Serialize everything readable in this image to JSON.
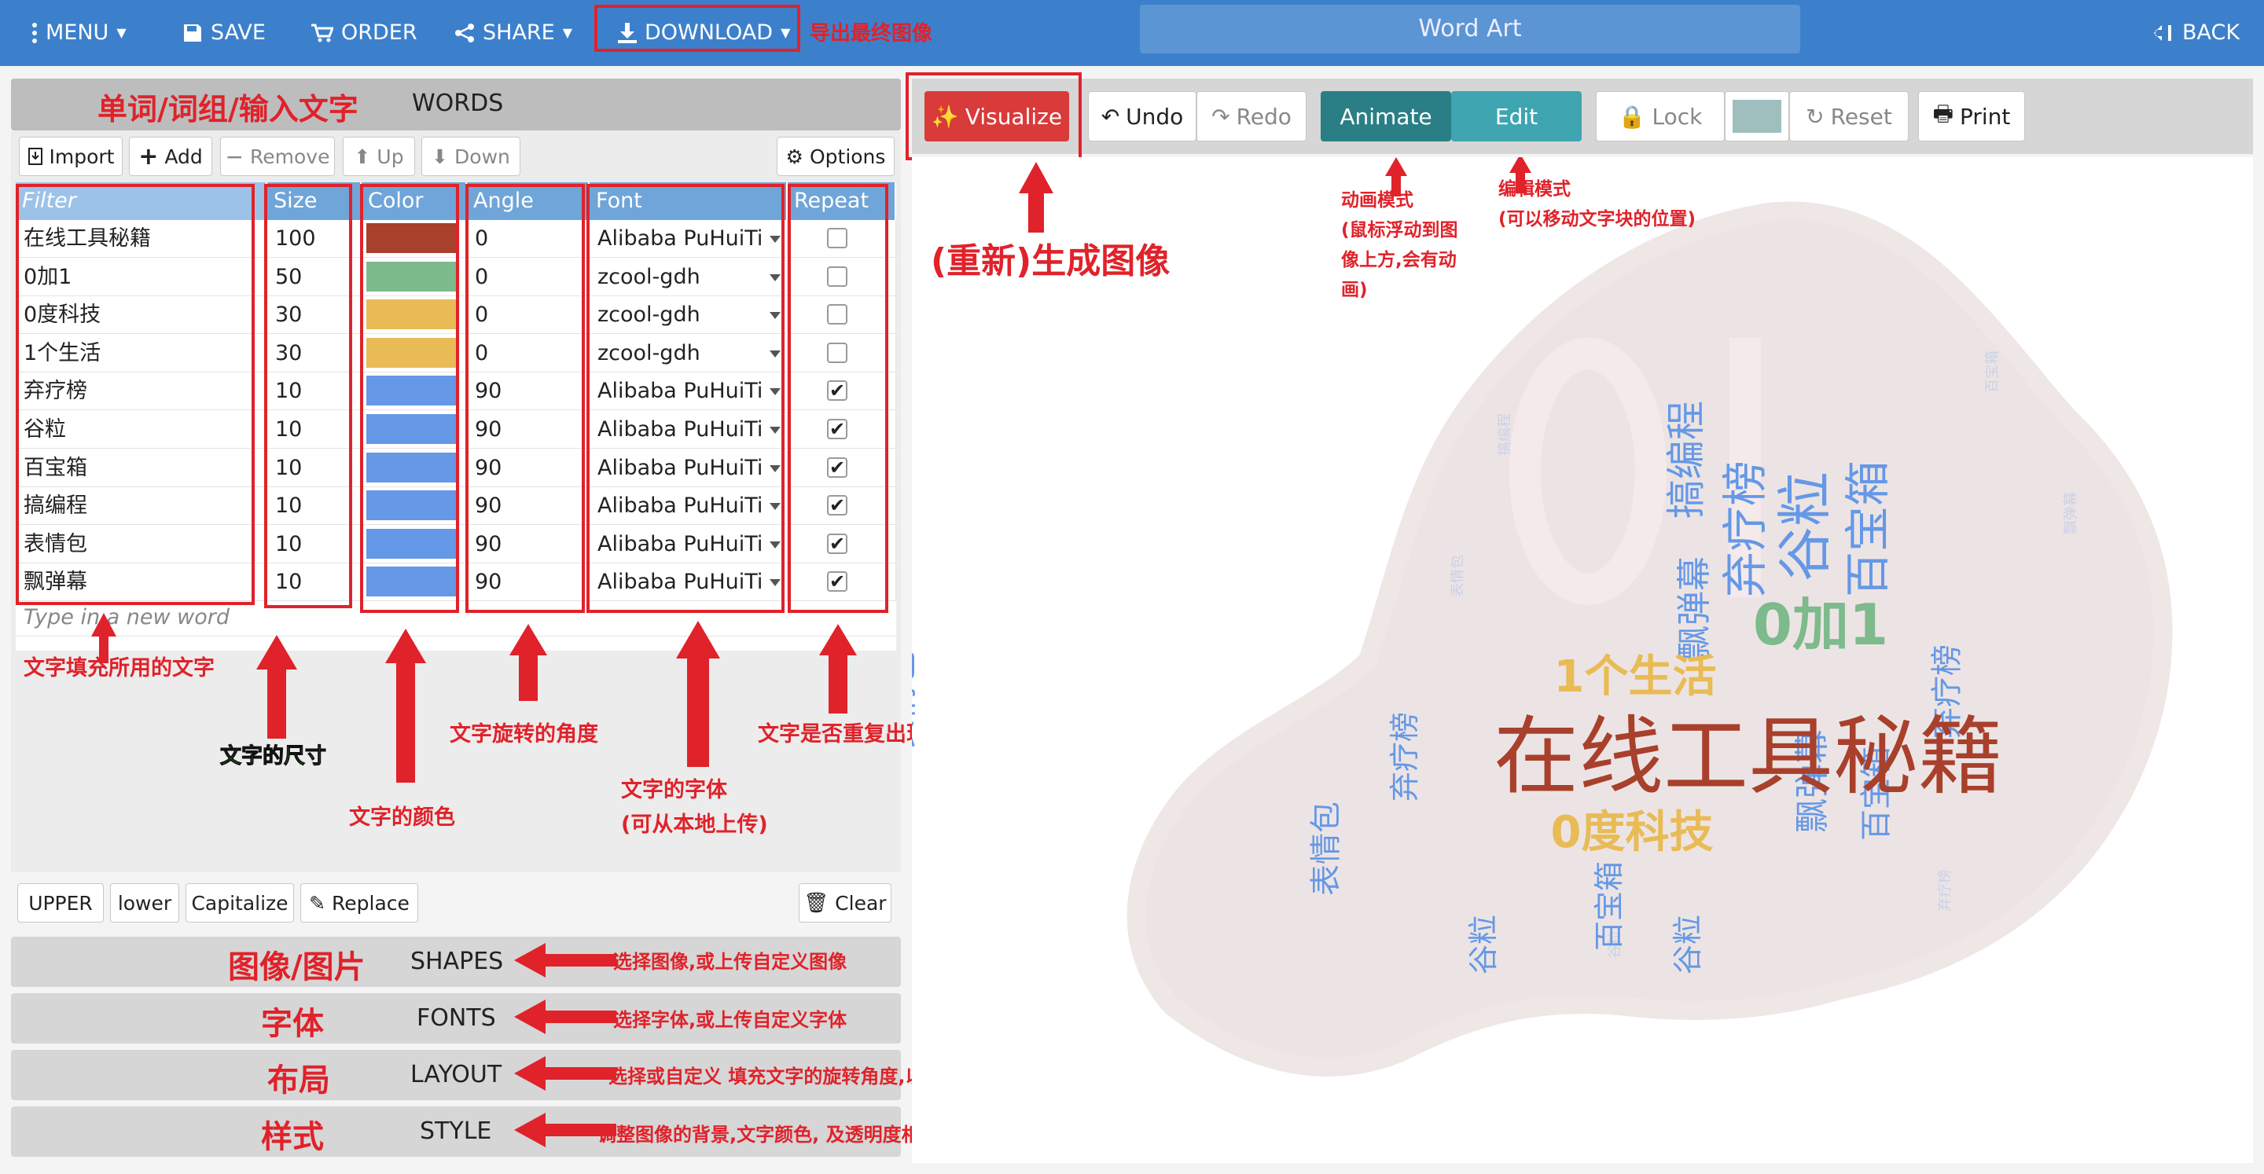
{
  "topbar": {
    "menu": "MENU",
    "save": "SAVE",
    "order": "ORDER",
    "share": "SHARE",
    "download": "DOWNLOAD",
    "title": "Word Art",
    "back": "BACK"
  },
  "annotations": {
    "download_note": "导出最终图像",
    "words_note": "单词/词组/输入文字",
    "visualize_note": "(重新)生成图像",
    "animate_note": "动画模式\n(鼠标浮动到图\n像上方,会有动\n画)",
    "edit_note": "编辑模式\n(可以移动文字块的位置)",
    "filter_note": "文字填充所用的文字",
    "size_note": "文字的尺寸",
    "color_note": "文字的颜色",
    "angle_note": "文字旋转的角度",
    "font_note": "文字的字体\n(可从本地上传)",
    "repeat_note": "文字是否重复出现",
    "shapes_cn": "图像/图片",
    "shapes_note": "选择图像,或上传自定义图像",
    "fonts_cn": "字体",
    "fonts_note": "选择字体,或上传自定义字体",
    "layout_cn": "布局",
    "layout_note": "选择或自定义 填充文字的旋转角度,以及单词填充的密度",
    "style_cn": "样式",
    "style_note": "调整图像的背景,文字颜色, 及透明度相关属性"
  },
  "words_panel": {
    "title": "WORDS",
    "toolbar": {
      "import": "Import",
      "add": "Add",
      "remove": "Remove",
      "up": "Up",
      "down": "Down",
      "options": "Options"
    },
    "headers": {
      "filter": "Filter",
      "size": "Size",
      "color": "Color",
      "angle": "Angle",
      "font": "Font",
      "repeat": "Repeat"
    },
    "rows": [
      {
        "word": "在线工具秘籍",
        "size": "100",
        "color": "#a8402c",
        "angle": "0",
        "font": "Alibaba PuHuiTi",
        "repeat": false
      },
      {
        "word": "0加1",
        "size": "50",
        "color": "#7dba8c",
        "angle": "0",
        "font": "zcool-gdh",
        "repeat": false
      },
      {
        "word": "0度科技",
        "size": "30",
        "color": "#e9bb55",
        "angle": "0",
        "font": "zcool-gdh",
        "repeat": false
      },
      {
        "word": "1个生活",
        "size": "30",
        "color": "#e9bb55",
        "angle": "0",
        "font": "zcool-gdh",
        "repeat": false
      },
      {
        "word": "弃疗榜",
        "size": "10",
        "color": "#6598e6",
        "angle": "90",
        "font": "Alibaba PuHuiTi",
        "repeat": true
      },
      {
        "word": "谷粒",
        "size": "10",
        "color": "#6598e6",
        "angle": "90",
        "font": "Alibaba PuHuiTi",
        "repeat": true
      },
      {
        "word": "百宝箱",
        "size": "10",
        "color": "#6598e6",
        "angle": "90",
        "font": "Alibaba PuHuiTi",
        "repeat": true
      },
      {
        "word": "搞编程",
        "size": "10",
        "color": "#6598e6",
        "angle": "90",
        "font": "Alibaba PuHuiTi",
        "repeat": true
      },
      {
        "word": "表情包",
        "size": "10",
        "color": "#6598e6",
        "angle": "90",
        "font": "Alibaba PuHuiTi",
        "repeat": true
      },
      {
        "word": "飘弹幕",
        "size": "10",
        "color": "#6598e6",
        "angle": "90",
        "font": "Alibaba PuHuiTi",
        "repeat": true
      }
    ],
    "new_word_placeholder": "Type in a new word",
    "bottom_buttons": {
      "upper": "UPPER",
      "lower": "lower",
      "capitalize": "Capitalize",
      "replace": "Replace",
      "clear": "Clear"
    }
  },
  "sections": {
    "shapes": "SHAPES",
    "fonts": "FONTS",
    "layout": "LAYOUT",
    "style": "STYLE"
  },
  "right_toolbar": {
    "visualize": "Visualize",
    "undo": "Undo",
    "redo": "Redo",
    "animate": "Animate",
    "edit": "Edit",
    "lock": "Lock",
    "reset": "Reset",
    "print": "Print"
  },
  "wordart": {
    "big": "在线工具秘籍",
    "mid": "0加1",
    "life": "1个生活",
    "tech": "0度科技",
    "w1": "弃疗榜",
    "w2": "谷粒",
    "w3": "百宝箱",
    "w4": "搞编程",
    "w5": "表情包",
    "w6": "飘弹幕"
  },
  "colors": {
    "topbar": "#3c80cc",
    "accent_red": "#e0222a",
    "visualize": "#d93a3a",
    "animate": "#2a7f86",
    "edit": "#3fa5b0",
    "wordart_blue": "#6598e6"
  }
}
